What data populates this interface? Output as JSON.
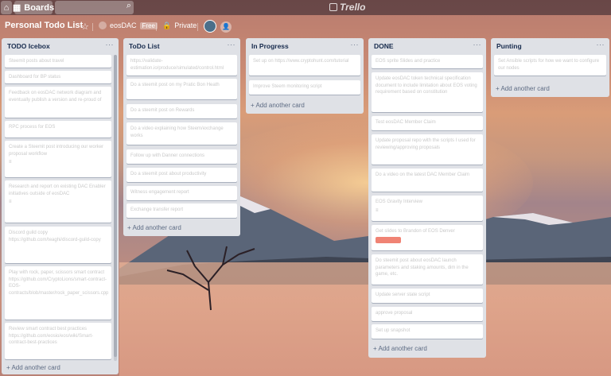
{
  "header": {
    "boards_label": "Boards",
    "logo_text": "Trello",
    "search_placeholder": ""
  },
  "board": {
    "title": "Personal Todo List",
    "team_name": "eosDAC",
    "team_badge": "Free",
    "visibility": "Private"
  },
  "lists": [
    {
      "title": "TODO Icebox",
      "add_label": "+ Add another card",
      "cards": [
        {
          "text": "Steemit posts about travel",
          "meta": ""
        },
        {
          "text": "Dashboard for BP status",
          "meta": ""
        },
        {
          "text": "Feedback on eosDAC network diagram and eventually publish a version and re-proud of",
          "meta": ""
        },
        {
          "text": "RPC process for EOS",
          "meta": ""
        },
        {
          "text": "Create a Steemit post introducing our worker proposal workflow",
          "meta": "≡"
        },
        {
          "text": "Research and report on existing DAC Enabler initiatives outside of eosDAC",
          "meta": "≡"
        },
        {
          "text": "Discord guild copy https://github.com/teaghi/discord-guild-copy",
          "meta": ""
        },
        {
          "text": "Play with rock, paper, scissors smart contract https://github.com/CryptoLions/smart-contract-EOS-contracts/blob/master/rock_paper_scissors.cpp",
          "meta": ""
        },
        {
          "text": "Review smart contract best practices https://github.com/eosio/eos/wiki/Smart-contract-best-practices",
          "meta": ""
        }
      ]
    },
    {
      "title": "ToDo List",
      "add_label": "+ Add another card",
      "cards": [
        {
          "text": "https://validate-estimation.io/produce/simulated/control.html",
          "meta": ""
        },
        {
          "text": "Do a steemit post on my Pratic Bon Heath",
          "meta": ""
        },
        {
          "text": "Do a steemit post on Rewards",
          "meta": ""
        },
        {
          "text": "Do a video explaining how Steem/exchange works",
          "meta": ""
        },
        {
          "text": "Follow up with Danner connections",
          "meta": ""
        },
        {
          "text": "Do a steemit post about productivity",
          "meta": ""
        },
        {
          "text": "Witness engagement report",
          "meta": ""
        },
        {
          "text": "Exchange transfer report",
          "meta": ""
        }
      ]
    },
    {
      "title": "In Progress",
      "add_label": "+ Add another card",
      "cards": [
        {
          "text": "Set up on https://www.cryptohunt.com/tutorial",
          "meta": ""
        },
        {
          "text": "Improve Steem monitoring script",
          "meta": ""
        }
      ]
    },
    {
      "title": "DONE",
      "add_label": "+ Add another card",
      "cards": [
        {
          "text": "EOS sprite Slides and practice",
          "meta": ""
        },
        {
          "text": "Update eosDAC token technical specification document to include limitation about EOS voting requirement based on constitution",
          "meta": ""
        },
        {
          "text": "Test eosDAC Member Claim",
          "meta": ""
        },
        {
          "text": "Update proposal repo with the scripts I used for reviewing/approving proposals",
          "meta": ""
        },
        {
          "text": "Do a video on the latest DAC Member Claim",
          "meta": ""
        },
        {
          "text": "EOS Gravity Interview",
          "meta": "≡"
        },
        {
          "text": "Get slides to Brandon of EOS Denver",
          "meta": "",
          "label": true
        },
        {
          "text": "Do steemit post about eosDAC launch parameters and staking amounts, dim in the game, etc.",
          "meta": ""
        },
        {
          "text": "Update server state script",
          "meta": ""
        },
        {
          "text": "approve proposal",
          "meta": ""
        },
        {
          "text": "Set up snapshot",
          "meta": ""
        }
      ]
    },
    {
      "title": "Punting",
      "add_label": "+ Add another card",
      "cards": [
        {
          "text": "Set Ansible scripts for how we want to configure our nodes",
          "meta": ""
        }
      ]
    }
  ],
  "colors": {
    "list_bg": "#dfe1e6",
    "card_bg": "#ffffff",
    "label_red": "#eb5a46"
  }
}
